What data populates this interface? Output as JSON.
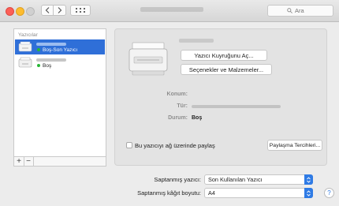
{
  "toolbar": {
    "search_placeholder": "Ara"
  },
  "printer_list": {
    "header": "Yazıcılar",
    "items": [
      {
        "status": "Boş-Son Yazıcı",
        "selected": true
      },
      {
        "status": "Boş",
        "selected": false
      }
    ],
    "add_label": "+",
    "remove_label": "−"
  },
  "detail": {
    "open_queue_label": "Yazıcı Kuyruğunu Aç...",
    "options_label": "Seçenekler ve Malzemeler...",
    "location_label": "Konum:",
    "type_label": "Tür:",
    "status_label": "Durum:",
    "status_value": "Boş",
    "share_checkbox_label": "Bu yazıcıyı ağ üzerinde paylaş",
    "sharing_prefs_label": "Paylaşma Tercihleri...",
    "share_checked": false
  },
  "defaults": {
    "default_printer_label": "Saptanmış yazıcı:",
    "default_printer_value": "Son Kullanılan Yazıcı",
    "paper_size_label": "Saptanmış kâğıt boyutu:",
    "paper_size_value": "A4"
  },
  "help_label": "?",
  "colors": {
    "accent": "#2f7be5",
    "selection": "#2f6fd8",
    "status_dot": "#27b635"
  },
  "icons": [
    "close-icon",
    "minimize-icon",
    "zoom-icon",
    "chevron-left-icon",
    "chevron-right-icon",
    "grid-icon",
    "search-icon",
    "printer-icon",
    "popup-arrows-icon",
    "help-icon"
  ]
}
